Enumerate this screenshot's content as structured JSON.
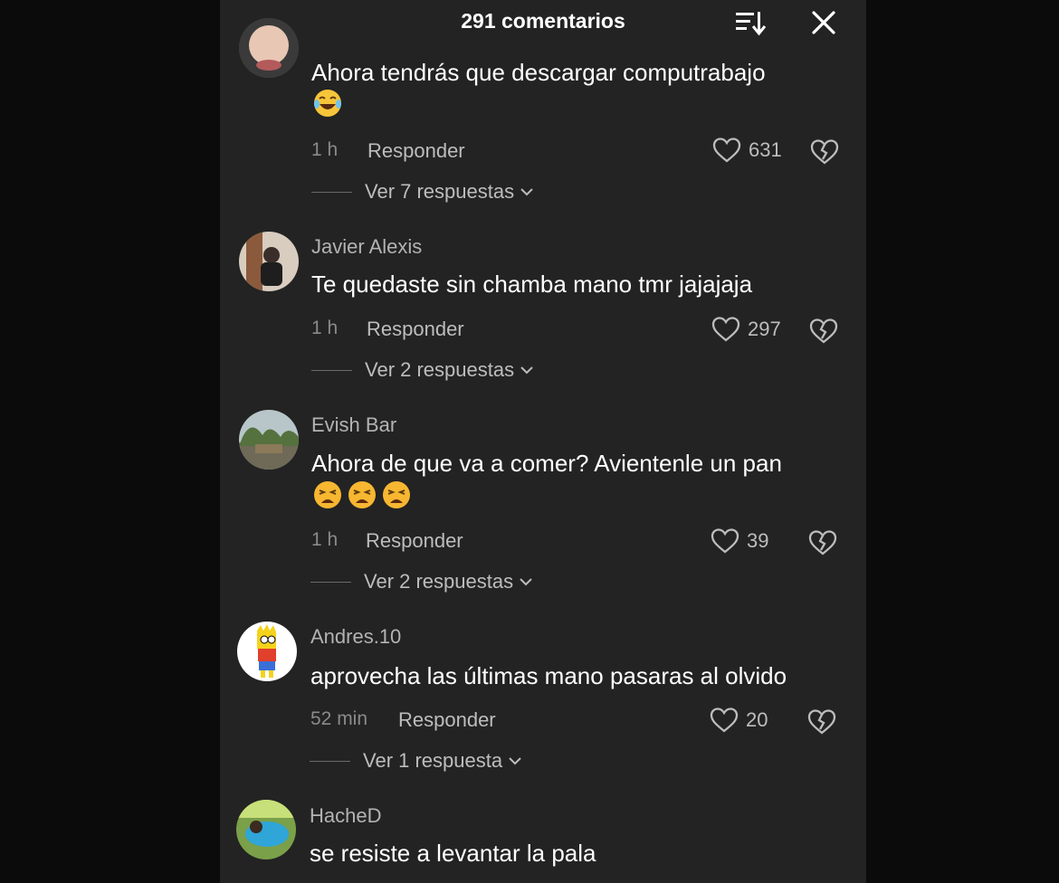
{
  "header": {
    "title": "291 comentarios"
  },
  "comments": [
    {
      "username": "",
      "text": "Ahora tendrás que descargar computrabajo",
      "emojis": [
        "laughing"
      ],
      "time": "1 h",
      "reply_label": "Responder",
      "likes": "631",
      "replies_label": "Ver 7 respuestas"
    },
    {
      "username": "Javier Alexis",
      "text": "Te quedaste sin chamba mano tmr jajajaja",
      "emojis": [],
      "time": "1 h",
      "reply_label": "Responder",
      "likes": "297",
      "replies_label": "Ver 2 respuestas"
    },
    {
      "username": "Evish Bar",
      "text": "Ahora de que va a comer? Avientenle un pan",
      "emojis": [
        "weary",
        "weary",
        "weary"
      ],
      "time": "1 h",
      "reply_label": "Responder",
      "likes": "39",
      "replies_label": "Ver 2 respuestas"
    },
    {
      "username": "Andres.10",
      "text": "aprovecha las últimas mano pasaras al olvido",
      "emojis": [],
      "time": "52 min",
      "reply_label": "Responder",
      "likes": "20",
      "replies_label": "Ver 1 respuesta"
    },
    {
      "username": "HacheD",
      "text": "se resiste a levantar la pala",
      "emojis": []
    }
  ],
  "colors": {
    "panel_bg": "#232323",
    "page_bg": "#0b0b0b",
    "text": "#ffffff",
    "muted": "#8a8a8a"
  }
}
